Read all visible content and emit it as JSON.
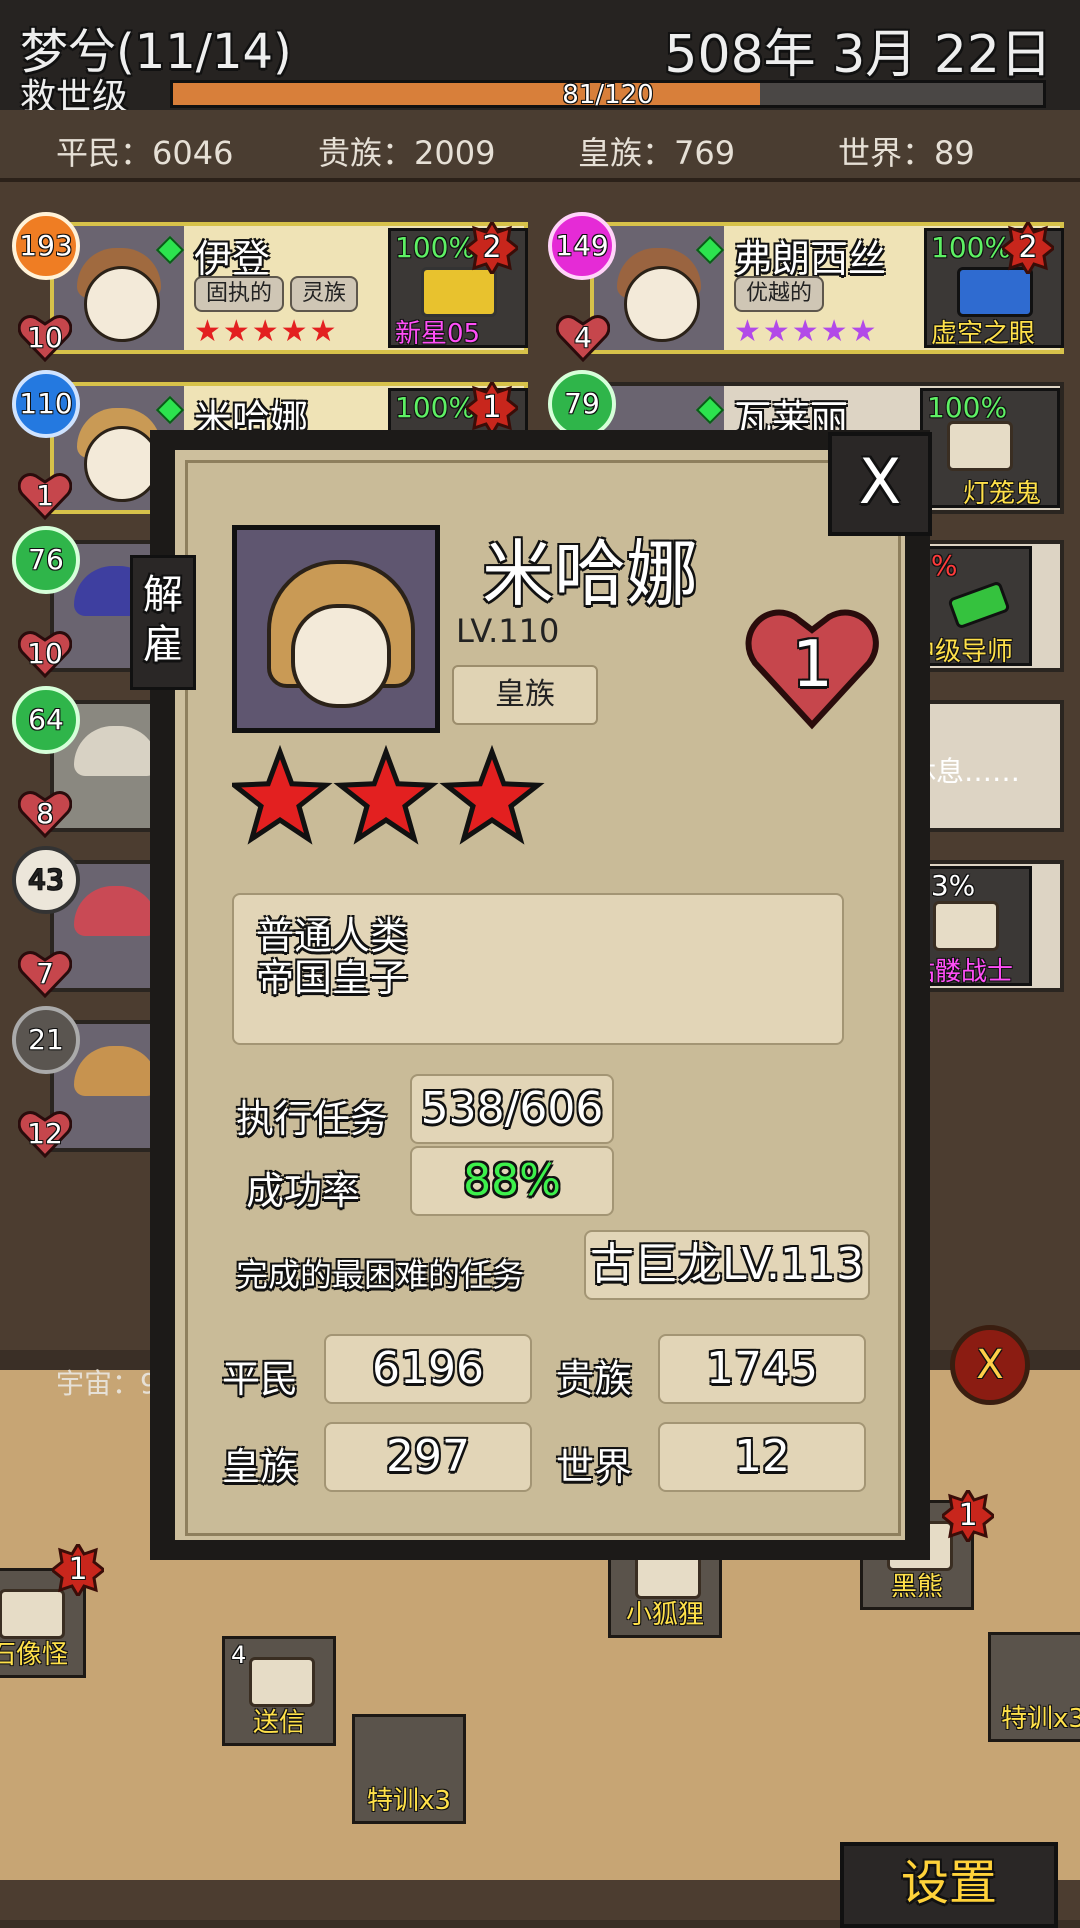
{
  "header": {
    "title": "梦兮(11/14)",
    "date": "508年 3月 22日",
    "rank": "救世级",
    "progress_text": "81/120",
    "progress_fraction": 0.675
  },
  "stats": {
    "commoner": "平民：6046",
    "noble": "贵族：2009",
    "royal": "皇族：769",
    "world": "世界：89"
  },
  "heroes": [
    {
      "name": "伊登",
      "tags": [
        "固执的",
        "灵族"
      ],
      "stars": "★★★★★",
      "task_pct": "100%",
      "task_name": "新星05",
      "level_badge": "193",
      "hearts": "10",
      "count": "2"
    },
    {
      "name": "弗朗西丝",
      "tags": [
        "优越的"
      ],
      "stars": "★★★★★",
      "task_pct": "100%",
      "task_name": "虚空之眼",
      "level_badge": "149",
      "hearts": "4",
      "count": "2"
    },
    {
      "name": "米哈娜",
      "task_pct": "100%",
      "level_badge": "110",
      "hearts": "1",
      "count": "1"
    },
    {
      "name": "瓦莱丽",
      "task_pct": "100%",
      "task_name": "灯笼鬼",
      "level_badge": "79"
    },
    {
      "level_badge": "76",
      "hearts": "10",
      "task_pct": "3%",
      "task_name": "中级导师"
    },
    {
      "level_badge": "64",
      "hearts": "8",
      "task_name": "休息……"
    },
    {
      "level_badge": "43",
      "hearts": "7",
      "task_pct": "53%",
      "task_name": "骷髅战士"
    },
    {
      "level_badge": "21",
      "hearts": "12"
    }
  ],
  "universe_label": "宇宙：9",
  "quests": [
    {
      "label": "石像怪",
      "count": "1"
    },
    {
      "label": "送信",
      "num": "4"
    },
    {
      "label": "特训x3"
    },
    {
      "label": "小狐狸"
    },
    {
      "label": "黑熊",
      "count": "1"
    },
    {
      "label": "特训x3"
    }
  ],
  "modal": {
    "close": "X",
    "dismiss": "解雇",
    "name": "米哈娜",
    "level": "LV.110",
    "class": "皇族",
    "hearts": "1",
    "stars": 3,
    "desc_line1": "普通人类",
    "desc_line2": "帝国皇子",
    "missions_label": "执行任务",
    "missions_value": "538/606",
    "success_label": "成功率",
    "success_value": "88%",
    "hardest_label": "完成的最困难的任务",
    "hardest_value": "古巨龙LV.113",
    "commoner_label": "平民",
    "commoner_value": "6196",
    "noble_label": "贵族",
    "noble_value": "1745",
    "royal_label": "皇族",
    "royal_value": "297",
    "world_label": "世界",
    "world_value": "12"
  },
  "settings_label": "设置",
  "colors": {
    "star": "#e32020",
    "success": "#3df04c",
    "task_pct": "#5ef064",
    "task_name": "#ff4ff7",
    "accent": "#d87f3a"
  }
}
